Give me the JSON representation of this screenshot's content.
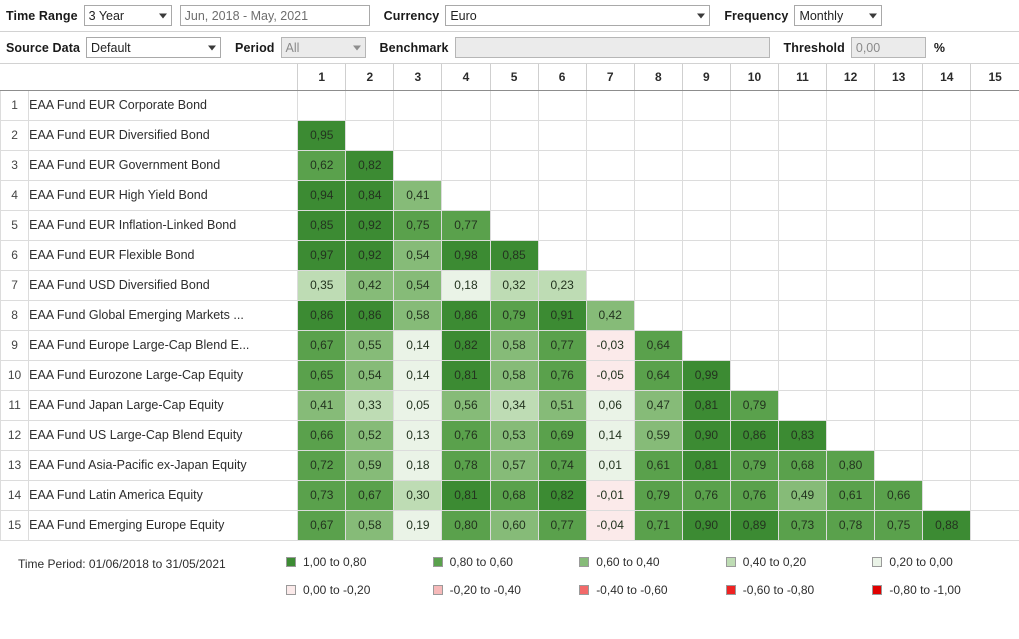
{
  "toolbar_top": {
    "time_range_label": "Time Range",
    "time_range_value": "3 Year",
    "date_range_value": "Jun, 2018 - May, 2021",
    "currency_label": "Currency",
    "currency_value": "Euro",
    "frequency_label": "Frequency",
    "frequency_value": "Monthly"
  },
  "toolbar_bottom": {
    "source_data_label": "Source Data",
    "source_data_value": "Default",
    "period_label": "Period",
    "period_value": "All",
    "benchmark_label": "Benchmark",
    "benchmark_value": "",
    "threshold_label": "Threshold",
    "threshold_value": "0,00",
    "percent_symbol": "%"
  },
  "chart_data": {
    "type": "heatmap",
    "title": "",
    "xlabel": "",
    "ylabel": "",
    "grid": true,
    "legend_position": "bottom",
    "column_headers": [
      "1",
      "2",
      "3",
      "4",
      "5",
      "6",
      "7",
      "8",
      "9",
      "10",
      "11",
      "12",
      "13",
      "14",
      "15"
    ],
    "row_numbers": [
      "1",
      "2",
      "3",
      "4",
      "5",
      "6",
      "7",
      "8",
      "9",
      "10",
      "11",
      "12",
      "13",
      "14",
      "15"
    ],
    "categories": [
      "EAA Fund EUR Corporate Bond",
      "EAA Fund EUR Diversified Bond",
      "EAA Fund EUR Government Bond",
      "EAA Fund EUR High Yield Bond",
      "EAA Fund EUR Inflation-Linked Bond",
      "EAA Fund EUR Flexible Bond",
      "EAA Fund USD Diversified Bond",
      "EAA Fund Global Emerging Markets ...",
      "EAA Fund Europe Large-Cap Blend E...",
      "EAA Fund Eurozone Large-Cap Equity",
      "EAA Fund Japan Large-Cap Equity",
      "EAA Fund US Large-Cap Blend Equity",
      "EAA Fund Asia-Pacific ex-Japan Equity",
      "EAA Fund Latin America Equity",
      "EAA Fund Emerging Europe Equity"
    ],
    "matrix": [
      [],
      [
        "0,95"
      ],
      [
        "0,62",
        "0,82"
      ],
      [
        "0,94",
        "0,84",
        "0,41"
      ],
      [
        "0,85",
        "0,92",
        "0,75",
        "0,77"
      ],
      [
        "0,97",
        "0,92",
        "0,54",
        "0,98",
        "0,85"
      ],
      [
        "0,35",
        "0,42",
        "0,54",
        "0,18",
        "0,32",
        "0,23"
      ],
      [
        "0,86",
        "0,86",
        "0,58",
        "0,86",
        "0,79",
        "0,91",
        "0,42"
      ],
      [
        "0,67",
        "0,55",
        "0,14",
        "0,82",
        "0,58",
        "0,77",
        "-0,03",
        "0,64"
      ],
      [
        "0,65",
        "0,54",
        "0,14",
        "0,81",
        "0,58",
        "0,76",
        "-0,05",
        "0,64",
        "0,99"
      ],
      [
        "0,41",
        "0,33",
        "0,05",
        "0,56",
        "0,34",
        "0,51",
        "0,06",
        "0,47",
        "0,81",
        "0,79"
      ],
      [
        "0,66",
        "0,52",
        "0,13",
        "0,76",
        "0,53",
        "0,69",
        "0,14",
        "0,59",
        "0,90",
        "0,86",
        "0,83"
      ],
      [
        "0,72",
        "0,59",
        "0,18",
        "0,78",
        "0,57",
        "0,74",
        "0,01",
        "0,61",
        "0,81",
        "0,79",
        "0,68",
        "0,80"
      ],
      [
        "0,73",
        "0,67",
        "0,30",
        "0,81",
        "0,68",
        "0,82",
        "-0,01",
        "0,79",
        "0,76",
        "0,76",
        "0,49",
        "0,61",
        "0,66"
      ],
      [
        "0,67",
        "0,58",
        "0,19",
        "0,80",
        "0,60",
        "0,77",
        "-0,04",
        "0,71",
        "0,90",
        "0,89",
        "0,73",
        "0,78",
        "0,75",
        "0,88"
      ]
    ],
    "values": [
      [],
      [
        0.95
      ],
      [
        0.62,
        0.82
      ],
      [
        0.94,
        0.84,
        0.41
      ],
      [
        0.85,
        0.92,
        0.75,
        0.77
      ],
      [
        0.97,
        0.92,
        0.54,
        0.98,
        0.85
      ],
      [
        0.35,
        0.42,
        0.54,
        0.18,
        0.32,
        0.23
      ],
      [
        0.86,
        0.86,
        0.58,
        0.86,
        0.79,
        0.91,
        0.42
      ],
      [
        0.67,
        0.55,
        0.14,
        0.82,
        0.58,
        0.77,
        -0.03,
        0.64
      ],
      [
        0.65,
        0.54,
        0.14,
        0.81,
        0.58,
        0.76,
        -0.05,
        0.64,
        0.99
      ],
      [
        0.41,
        0.33,
        0.05,
        0.56,
        0.34,
        0.51,
        0.06,
        0.47,
        0.81,
        0.79
      ],
      [
        0.66,
        0.52,
        0.13,
        0.76,
        0.53,
        0.69,
        0.14,
        0.59,
        0.9,
        0.86,
        0.83
      ],
      [
        0.72,
        0.59,
        0.18,
        0.78,
        0.57,
        0.74,
        0.01,
        0.61,
        0.81,
        0.79,
        0.68,
        0.8
      ],
      [
        0.73,
        0.67,
        0.3,
        0.81,
        0.68,
        0.82,
        -0.01,
        0.79,
        0.76,
        0.76,
        0.49,
        0.61,
        0.66
      ],
      [
        0.67,
        0.58,
        0.19,
        0.8,
        0.6,
        0.77,
        -0.04,
        0.71,
        0.9,
        0.89,
        0.73,
        0.78,
        0.75,
        0.88
      ]
    ],
    "colorbins": [
      {
        "label": "1,00 to 0,80",
        "min": 0.8,
        "max": 1.0,
        "color": "#3c8b33",
        "class": "g1"
      },
      {
        "label": "0,80 to 0,60",
        "min": 0.6,
        "max": 0.8,
        "color": "#5aa14c",
        "class": "g2"
      },
      {
        "label": "0,60 to 0,40",
        "min": 0.4,
        "max": 0.6,
        "color": "#86bb78",
        "class": "g3"
      },
      {
        "label": "0,40 to 0,20",
        "min": 0.2,
        "max": 0.4,
        "color": "#bedcb4",
        "class": "g4"
      },
      {
        "label": "0,20 to 0,00",
        "min": 0.0,
        "max": 0.2,
        "color": "#eaf3e7",
        "class": "g5"
      },
      {
        "label": "0,00 to -0,20",
        "min": -0.2,
        "max": 0.0,
        "color": "#fbeaea",
        "class": "r1"
      },
      {
        "label": "-0,20 to -0,40",
        "min": -0.4,
        "max": -0.2,
        "color": "#f6b9b9",
        "class": "r2"
      },
      {
        "label": "-0,40 to -0,60",
        "min": -0.6,
        "max": -0.4,
        "color": "#f26a6a",
        "class": "r3"
      },
      {
        "label": "-0,60 to -0,80",
        "min": -0.8,
        "max": -0.6,
        "color": "#ef2222",
        "class": "r4"
      },
      {
        "label": "-0,80 to -1,00",
        "min": -1.0,
        "max": -0.8,
        "color": "#e00000",
        "class": "r5"
      }
    ]
  },
  "footer": {
    "time_period_text": "Time Period: 01/06/2018 to 31/05/2021"
  }
}
